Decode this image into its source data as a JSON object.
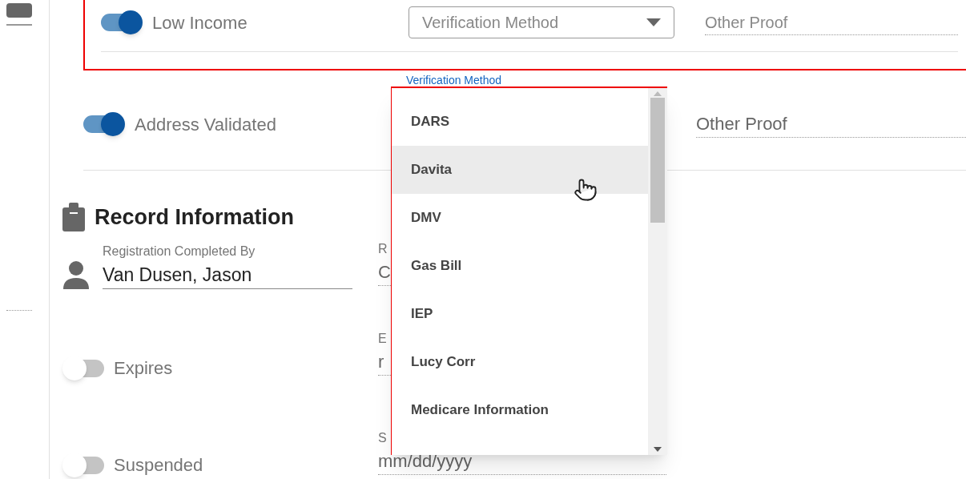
{
  "income_section": {
    "toggle": {
      "label": "Low Income",
      "on": true
    },
    "verification_select": {
      "placeholder": "Verification Method"
    },
    "other_proof": {
      "placeholder": "Other Proof"
    }
  },
  "address_row": {
    "toggle": {
      "label": "Address Validated",
      "on": true
    },
    "verification_label": "Verification Method",
    "other_proof": {
      "placeholder": "Other Proof"
    }
  },
  "dropdown": {
    "options": [
      {
        "label": "DARS",
        "hovered": false
      },
      {
        "label": "Davita",
        "hovered": true
      },
      {
        "label": "DMV",
        "hovered": false
      },
      {
        "label": "Gas Bill",
        "hovered": false
      },
      {
        "label": "IEP",
        "hovered": false
      },
      {
        "label": "Lucy Corr",
        "hovered": false
      },
      {
        "label": "Medicare Information",
        "hovered": false
      }
    ]
  },
  "record": {
    "title": "Record Information",
    "completed_by": {
      "label": "Registration Completed By",
      "value": "Van Dusen, Jason"
    },
    "toggles": [
      {
        "label": "Expires",
        "on": false
      },
      {
        "label": "Suspended",
        "on": false
      }
    ],
    "side_fields": [
      {
        "label": "R",
        "value": "C"
      },
      {
        "label": "E",
        "value": "r"
      },
      {
        "label": "S",
        "value": "mm/dd/yyyy"
      }
    ]
  }
}
